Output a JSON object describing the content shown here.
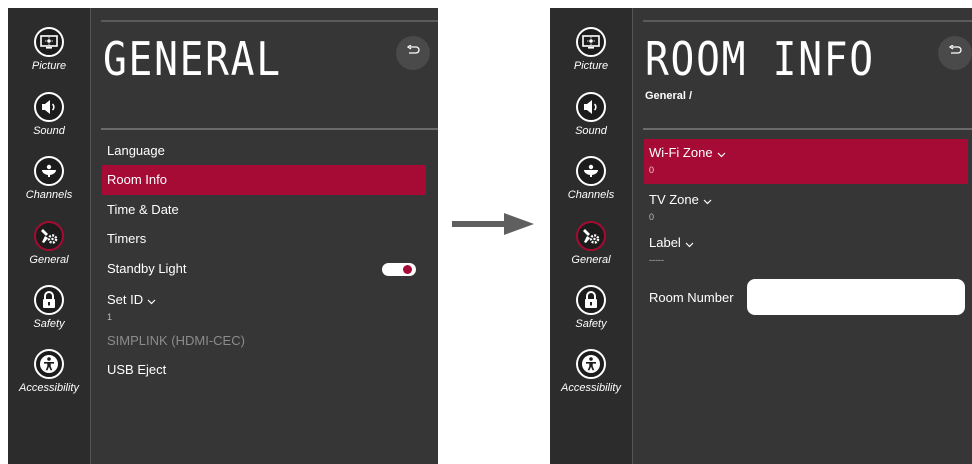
{
  "colors": {
    "accent": "#a50b34",
    "panel_bg": "#363636",
    "sidebar_bg": "#2c2c2c",
    "arrow": "#5f5f5f"
  },
  "sidebar": {
    "items": [
      {
        "label": "Picture",
        "icon": "picture-icon"
      },
      {
        "label": "Sound",
        "icon": "sound-icon"
      },
      {
        "label": "Channels",
        "icon": "channels-icon"
      },
      {
        "label": "General",
        "icon": "general-icon"
      },
      {
        "label": "Safety",
        "icon": "safety-icon"
      },
      {
        "label": "Accessibility",
        "icon": "accessibility-icon"
      }
    ],
    "active": "General"
  },
  "general_screen": {
    "title": "GENERAL",
    "back_icon": "back-icon",
    "menu": [
      {
        "label": "Language"
      },
      {
        "label": "Room Info",
        "selected": true
      },
      {
        "label": "Time & Date"
      },
      {
        "label": "Timers"
      },
      {
        "label": "Standby Light",
        "toggle": true,
        "toggle_on": true
      },
      {
        "label": "Set ID",
        "value": "1",
        "dropdown": true
      },
      {
        "label": "SIMPLINK (HDMI-CEC)",
        "disabled": true
      },
      {
        "label": "USB Eject"
      }
    ]
  },
  "room_info_screen": {
    "title": "ROOM INFO",
    "breadcrumb": "General /",
    "back_icon": "back-icon",
    "fields": [
      {
        "label": "Wi-Fi Zone",
        "value": "0",
        "selected": true
      },
      {
        "label": "TV Zone",
        "value": "0"
      },
      {
        "label": "Label",
        "value": "-----"
      }
    ],
    "room_number_label": "Room Number",
    "room_number_value": ""
  },
  "transition_icon": "arrow-right-icon"
}
